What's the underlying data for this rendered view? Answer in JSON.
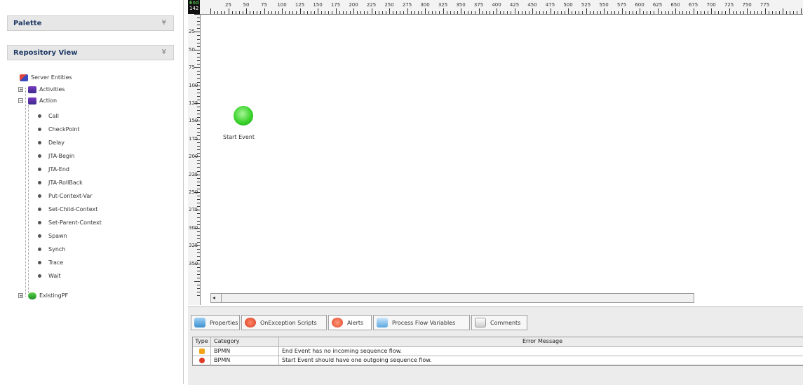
{
  "palette": {
    "title": "Palette",
    "chevron": "¥"
  },
  "repository": {
    "title": "Repository View",
    "chevron": "¥",
    "tree": {
      "root": "Server Entities",
      "activities": "Activities",
      "action": "Action",
      "action_children": [
        "Call",
        "CheckPoint",
        "Delay",
        "JTA-Begin",
        "JTA-End",
        "JTA-RollBack",
        "Put-Context-Var",
        "Set-Child-Context",
        "Set-Parent-Context",
        "Spawn",
        "Synch",
        "Trace",
        "Wait"
      ],
      "pf": "ExistingPF"
    }
  },
  "canvas": {
    "corner_top": "End",
    "corner_value": "142",
    "ruler_x": [
      "25",
      "50",
      "75",
      "100",
      "125",
      "150",
      "175",
      "200",
      "225",
      "250",
      "275",
      "300",
      "325",
      "350",
      "375",
      "400",
      "425",
      "450",
      "475",
      "500",
      "525",
      "550",
      "575",
      "600",
      "625",
      "650",
      "675",
      "700",
      "725",
      "750",
      "775"
    ],
    "ruler_y": [
      "25",
      "50",
      "75",
      "100",
      "125",
      "150",
      "175",
      "200",
      "225",
      "250",
      "275",
      "300",
      "325",
      "350"
    ],
    "start_event_label": "Start Event"
  },
  "bottom": {
    "tabs": [
      "Properties",
      "OnException Scripts",
      "Alerts",
      "Process Flow Variables",
      "Comments"
    ],
    "columns": [
      "Type",
      "Category",
      "Error Message"
    ],
    "rows": [
      {
        "type_icon": "warning-icon",
        "category": "BPMN",
        "message": "End Event has no incoming sequence flow."
      },
      {
        "type_icon": "error-icon",
        "category": "BPMN",
        "message": "Start Event should have one outgoing sequence flow."
      }
    ]
  }
}
